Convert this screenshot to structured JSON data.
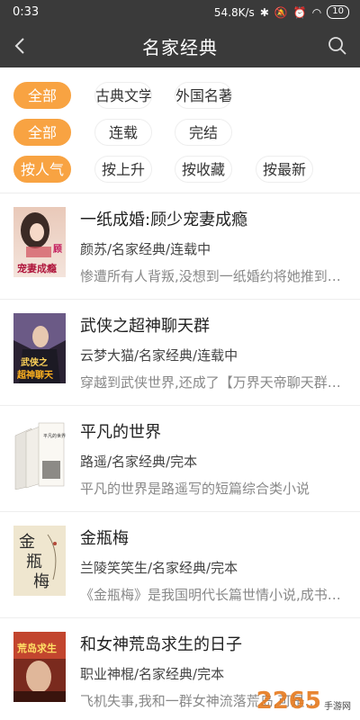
{
  "status": {
    "time": "0:33",
    "speed": "54.8K/s",
    "battery": "10"
  },
  "nav": {
    "title": "名家经典"
  },
  "filters": {
    "row1": [
      "全部",
      "古典文学",
      "外国名著"
    ],
    "row2": [
      "全部",
      "连载",
      "完结"
    ],
    "row3": [
      "按人气",
      "按上升",
      "按收藏",
      "按最新"
    ]
  },
  "books": [
    {
      "title": "一纸成婚:顾少宠妻成瘾",
      "meta": "颜苏/名家经典/连载中",
      "desc": "惨遭所有人背叛,没想到一纸婚约将她推到了顾少身边",
      "cover_text": "顾少 宠妻成瘾"
    },
    {
      "title": "武侠之超神聊天群",
      "meta": "云梦大猫/名家经典/连载中",
      "desc": "穿越到武侠世界,还成了【万界天帝聊天群】群主",
      "cover_text": "武侠之 超神聊天群"
    },
    {
      "title": "平凡的世界",
      "meta": "路遥/名家经典/完本",
      "desc": "平凡的世界是路遥写的短篇综合类小说",
      "cover_text": "平凡的世界"
    },
    {
      "title": "金瓶梅",
      "meta": "兰陵笑笑生/名家经典/完本",
      "desc": "《金瓶梅》是我国明代长篇世情小说,成书约在明朝",
      "cover_text": "金瓶梅"
    },
    {
      "title": "和女神荒岛求生的日子",
      "meta": "职业神棍/名家经典/完本",
      "desc": "飞机失事,我和一群女神流落荒岛,可是…",
      "cover_text": "和女神 荒岛求生"
    }
  ],
  "watermark": {
    "big": "2265",
    "small": "手游网",
    "url": ".com"
  },
  "colors": {
    "accent": "#f8a342",
    "topbar": "#3a3a3a"
  }
}
